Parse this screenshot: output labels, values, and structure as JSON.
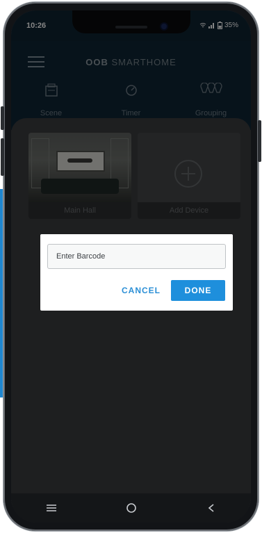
{
  "status": {
    "time": "10:26",
    "battery": "35%"
  },
  "app": {
    "title_bold": "OOB",
    "title_rest": "SMARTHOME"
  },
  "tabs": [
    {
      "label": "Scene",
      "icon": "scene-icon"
    },
    {
      "label": "Timer",
      "icon": "timer-icon"
    },
    {
      "label": "Grouping",
      "icon": "grouping-icon"
    }
  ],
  "cards": [
    {
      "label": "Main Hall"
    },
    {
      "label": "Add Device",
      "icon": "plus-circle-icon"
    }
  ],
  "dialog": {
    "placeholder": "Enter Barcode",
    "value": "",
    "cancel_label": "CANCEL",
    "done_label": "DONE"
  },
  "colors": {
    "accent": "#1e8fdc",
    "appbar": "#0f2534",
    "side_accent": "#1f86d0"
  }
}
